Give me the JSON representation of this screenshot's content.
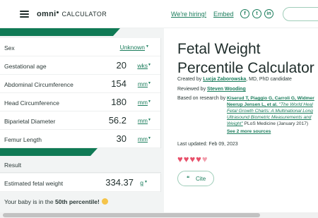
{
  "header": {
    "logo_main": "omni",
    "logo_sub": "CALCULATOR",
    "hiring": "We're hiring!",
    "embed": "Embed",
    "social": [
      {
        "icon": "facebook-icon",
        "glyph": "f"
      },
      {
        "icon": "twitter-icon",
        "glyph": "t"
      },
      {
        "icon": "linkedin-icon",
        "glyph": "in"
      }
    ]
  },
  "inputs": {
    "sex": {
      "label": "Sex",
      "value": "Unknown"
    },
    "gestational_age": {
      "label": "Gestational age",
      "value": "20",
      "unit": "wks"
    },
    "abdominal": {
      "label": "Abdominal Circumference",
      "value": "154",
      "unit": "mm"
    },
    "head": {
      "label": "Head Circumference",
      "value": "180",
      "unit": "mm"
    },
    "biparietal": {
      "label": "Biparietal Diameter",
      "value": "56.2",
      "unit": "mm"
    },
    "femur": {
      "label": "Femur Length",
      "value": "30",
      "unit": "mm"
    }
  },
  "result": {
    "heading": "Result",
    "weight_label": "Estimated fetal weight",
    "weight_value": "334.37",
    "weight_unit": "g",
    "percentile_prefix": "Your baby is in the ",
    "percentile_value": "50th percentile!"
  },
  "article": {
    "title": "Fetal Weight Percentile Calculator",
    "created_prefix": "Created by ",
    "author": "Lucja Zaborowska",
    "author_suffix": ", MD, PhD candidate",
    "reviewed_prefix": "Reviewed by ",
    "reviewer": "Steven Wooding",
    "research_prefix": "Based on research by",
    "research_authors": "Kiserud T, Piaggio G, Carroli G, Widmer",
    "research_line2a": "Neerup Jensen L, et al. ",
    "research_line2b": "\"The World Heal",
    "research_line3": "Fetal Growth Charts: A Multinational Long",
    "research_line4": "Ultrasound Biometric Measurements and",
    "research_line5a": "Weight\"",
    "research_line5b": " PLoS Medicine (January 2017)",
    "more_sources": "See 2 more sources",
    "updated": "Last updated: Feb 09, 2023",
    "rating_hearts": 4.5,
    "cite": "Cite"
  }
}
